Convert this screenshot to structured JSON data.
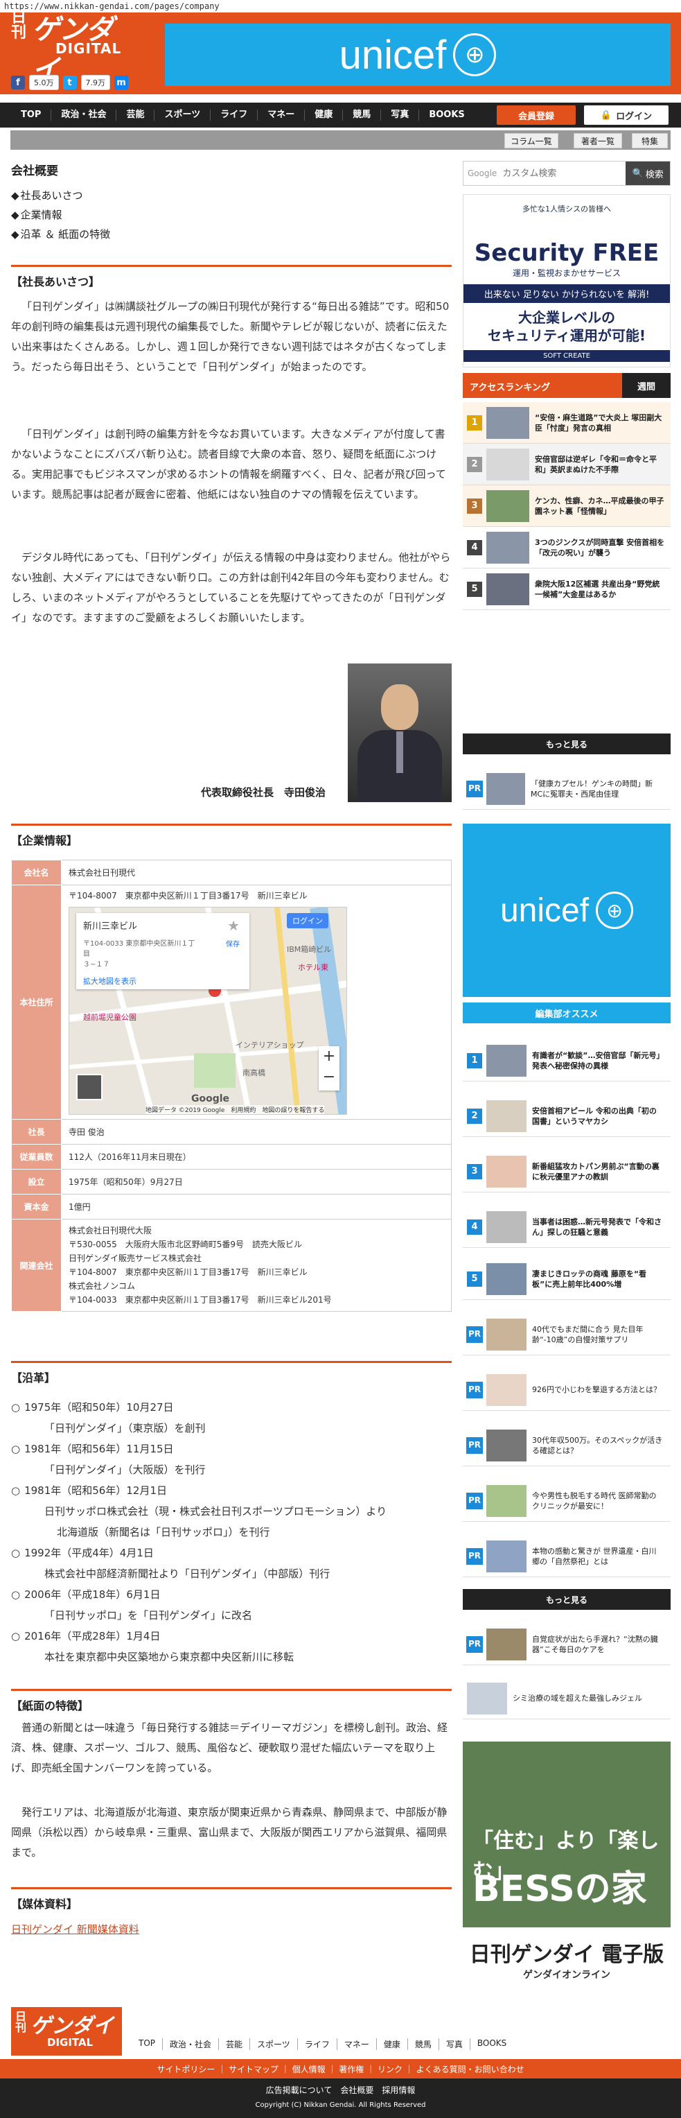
{
  "url": "https://www.nikkan-gendai.com/pages/company",
  "header": {
    "logo_nikkan": "日刊",
    "logo_gendai": "ゲンダイ",
    "logo_digital": "DIGITAL",
    "fb_count": "5.0万",
    "tw_count": "7.9万",
    "banner_text": "unicef"
  },
  "nav": {
    "items": [
      "TOP",
      "政治・社会",
      "芸能",
      "スポーツ",
      "ライフ",
      "マネー",
      "健康",
      "競馬",
      "写真",
      "BOOKS"
    ],
    "register": "会員登録",
    "login": "ログイン",
    "sub": [
      "コラム一覧",
      "著者一覧",
      "特集"
    ]
  },
  "page": {
    "title": "会社概要",
    "toc": [
      "社長あいさつ",
      "企業情報",
      "沿革 ＆ 紙面の特徴"
    ]
  },
  "greeting": {
    "heading": "【社長あいさつ】",
    "p1": "「日刊ゲンダイ」は㈱講談社グループの㈱日刊現代が発行する“毎日出る雑誌”です。昭和50年の創刊時の編集長は元週刊現代の編集長でした。新聞やテレビが報じないが、読者に伝えたい出来事はたくさんある。しかし、週１回しか発行できない週刊誌ではネタが古くなってしまう。だったら毎日出そう、ということで「日刊ゲンダイ」が始まったのです。",
    "p2": "「日刊ゲンダイ」は創刊時の編集方針を今なお貫いています。大きなメディアが付度して書かないようなことにズバズバ斬り込む。読者目線で大衆の本音、怒り、疑問を紙面にぶつける。実用記事でもビジネスマンが求めるホントの情報を網羅すべく、日々、記者が飛び回っています。競馬記事は記者が厩舎に密着、他紙にはない独自のナマの情報を伝えています。",
    "p3": "デジタル時代にあっても、「日刊ゲンダイ」が伝える情報の中身は変わりません。他社がやらない独創、大メディアにはできない斬り口。この方針は創刊42年目の今年も変わりません。むしろ、いまのネットメディアがやろうとしていることを先駆けてやってきたのが「日刊ゲンダイ」なのです。ますますのご愛顧をよろしくお願いいたします。",
    "ceo": "代表取締役社長　寺田俊治"
  },
  "company": {
    "heading": "【企業情報】",
    "rows": [
      {
        "label": "会社名",
        "value": "株式会社日刊現代"
      },
      {
        "label": "本社住所",
        "value": "〒104-8007　東京都中央区新川１丁目3番17号　新川三幸ビル"
      },
      {
        "label": "社長",
        "value": "寺田 俊治"
      },
      {
        "label": "従業員数",
        "value": "112人（2016年11月末日現在）"
      },
      {
        "label": "設立",
        "value": "1975年（昭和50年）9月27日"
      },
      {
        "label": "資本金",
        "value": "1億円"
      },
      {
        "label": "関連会社",
        "value": "株式会社日刊現代大阪"
      }
    ],
    "related_lines": [
      "〒530-0055　大阪府大阪市北区野崎町5番9号　読売大阪ビル",
      "日刊ゲンダイ販売サービス株式会社",
      "〒104-8007　東京都中央区新川１丁目3番17号　新川三幸ビル",
      "株式会社ノンコム",
      "〒104-0033　東京都中央区新川１丁目3番17号　新川三幸ビル201号"
    ],
    "map": {
      "place": "新川三幸ビル",
      "addr1": "〒104-0033 東京都中央区新川１丁目",
      "addr2": "３−１７",
      "save": "保存",
      "enlarge": "拡大地図を表示",
      "login": "ログイン",
      "label1": "IBM箱崎ビル",
      "label2": "インテリアショップ",
      "label3": "越前堀児童公園",
      "label4": "南高橋",
      "label5": "ホテル東",
      "credit": "地図データ ©2019 Google　利用規約　地図の誤りを報告する",
      "google": "Google"
    }
  },
  "history": {
    "heading": "【沿革】",
    "items": [
      {
        "year": "1975年（昭和50年）10月27日",
        "event": "「日刊ゲンダイ」（東京版）を創刊"
      },
      {
        "year": "1981年（昭和56年）11月15日",
        "event": "「日刊ゲンダイ」（大阪版）を刊行"
      },
      {
        "year": "1981年（昭和56年）12月1日",
        "event": "日刊サッポロ株式会社（現・株式会社日刊スポーツプロモーション）より"
      },
      {
        "year": "1992年（平成4年）4月1日",
        "event": "株式会社中部経済新聞社より「日刊ゲンダイ」（中部版）刊行"
      },
      {
        "year": "2006年（平成18年）6月1日",
        "event": "「日刊サッポロ」を「日刊ゲンダイ」に改名"
      },
      {
        "year": "2016年（平成28年）1月4日",
        "event": "本社を東京都中央区築地から東京都中央区新川に移転"
      }
    ],
    "extra_line": "北海道版（新聞名は「日刊サッポロ」）を刊行"
  },
  "features": {
    "heading": "【紙面の特徴】",
    "p1": "普通の新聞とは一味違う「毎日発行する雑誌＝デイリーマガジン」を標榜し創刊。政治、経済、株、健康、スポーツ、ゴルフ、競馬、風俗など、硬軟取り混ぜた幅広いテーマを取り上げ、即売紙全国ナンバーワンを誇っている。",
    "p2": "発行エリアは、北海道版が北海道、東京版が関東近県から青森県、静岡県まで、中部版が静岡県（浜松以西）から岐阜県・三重県、富山県まで、大阪版が関西エリアから滋賀県、福岡県まで。"
  },
  "media": {
    "heading": "【媒体資料】",
    "link": "日刊ゲンダイ 新聞媒体資料"
  },
  "sidebar": {
    "search_placeholder": "カスタム検索",
    "search_google": "Google",
    "search_btn": "検索",
    "ad1": {
      "a": "多忙な1人情シスの皆様へ",
      "b": "Security FREE",
      "c": "運用・監視おまかせサービス",
      "d": "出来ない 足りない かけられないを 解消!",
      "e1": "大企業レベルの",
      "e2": "セキュリティ運用が可能!",
      "f": "SOFT CREATE"
    },
    "rank_tab": "アクセスランキング",
    "rank_tab2": "週間",
    "rank": [
      {
        "n": "1",
        "t": "“安倍・麻生道路”で大炎上 塚田副大臣「忖度」発言の真相"
      },
      {
        "n": "2",
        "t": "安倍官邸は逆ギレ「令和＝命令と平和」英訳まぬけた不手際"
      },
      {
        "n": "3",
        "t": "ケンカ、性癖、カネ…平成最後の甲子園ネット裏「怪情報」"
      },
      {
        "n": "4",
        "t": "3つのジンクスが同時直撃 安倍首相を「改元の呪い」が襲う"
      },
      {
        "n": "5",
        "t": "衆院大阪12区補選 共産出身“野党統一候補”大金星はあるか"
      }
    ],
    "more": "もっと見る",
    "pr1": "「健康カプセル！ゲンキの時間」新MCに冤罪夫・西尾由佳理",
    "pr_label": "PR",
    "ad2": "unicef",
    "rec_head": "編集部オススメ",
    "rec": [
      {
        "n": "1",
        "t": "有識者が“歓談”…安倍官邸「新元号」発表へ秘密保持の異様"
      },
      {
        "n": "2",
        "t": "安倍首相アピール 令和の出典「初の国書」というマヤカシ"
      },
      {
        "n": "3",
        "t": "新番組猛攻カトパン男前ぶ“言動の裏に秋元優里アナの教訓"
      },
      {
        "n": "4",
        "t": "当事者は困惑…新元号発表で「令和さん」探しの狂騒と意義"
      },
      {
        "n": "5",
        "t": "凄まじきロッテの商魂 藤原を“看板”に売上前年比400%増"
      }
    ],
    "pr_items": [
      "40代でもまだ間に合う 見た目年齢“-10歳”の自慢対策サプリ",
      "926円で小じわを撃退する方法とは？",
      "30代年収500万。そのスペックが活きる確認とは？",
      "今や男性も脱毛する時代 医師常勤のクリニックが最安に！",
      "本物の感動と驚きが 世界遺産・白川郷の「自然祭祀」とは"
    ],
    "pr_last": "自覚症状が出たら手遅れ？“沈黙の臓器”こそ毎日のケアを",
    "pr_extra": "シミ治療の域を超えた最強しみジェル",
    "ad3": {
      "t1": "「住む」より「楽しむ」",
      "t2": "BESSの家",
      "l1": "日刊ゲンダイ 電子版",
      "l2": "ゲンダイオンライン"
    }
  },
  "footer": {
    "nav": [
      "TOP",
      "政治・社会",
      "芸能",
      "スポーツ",
      "ライフ",
      "マネー",
      "健康",
      "競馬",
      "写真",
      "BOOKS"
    ],
    "bar": "サイトポリシー ｜ サイトマップ ｜ 個人情報 ｜ 著作権 ｜ リンク ｜ よくある質問・お問い合わせ",
    "bottom1": "広告掲載について　会社概要　採用情報",
    "copyright": "Copyright (C) Nikkan Gendai. All Rights Reserved"
  }
}
